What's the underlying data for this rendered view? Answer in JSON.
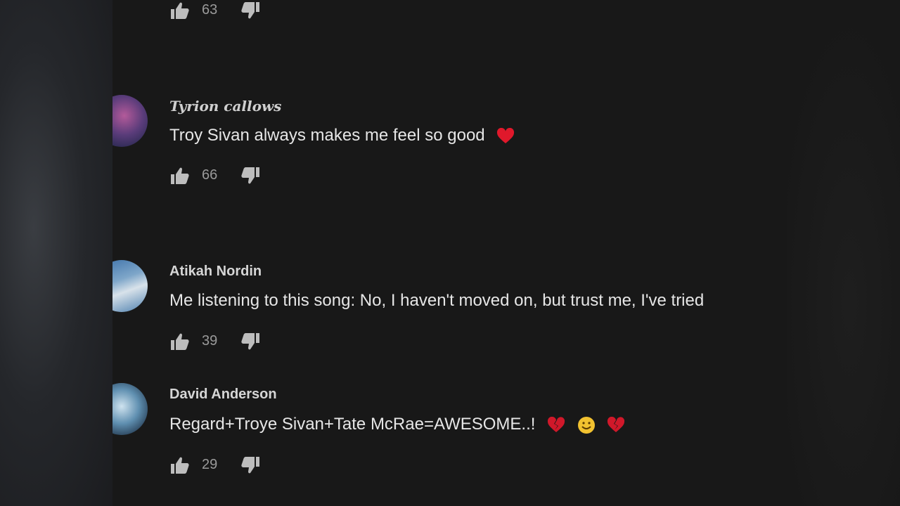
{
  "comments": [
    {
      "author": "",
      "text": "",
      "likes": "63"
    },
    {
      "author": "Tyrion callows",
      "text": "Troy Sivan always makes me feel so good",
      "likes": "66",
      "emoji": [
        "red-heart"
      ]
    },
    {
      "author": "Atikah Nordin",
      "text": "Me listening to this song: No, I haven't moved on, but trust me, I've tried",
      "likes": "39"
    },
    {
      "author": "David Anderson",
      "text": "Regard+Troye Sivan+Tate McRae=AWESOME..!",
      "likes": "29",
      "emoji": [
        "broken-heart",
        "smiling-face",
        "broken-heart"
      ]
    }
  ],
  "icons": {
    "like": "thumbs-up-icon",
    "dislike": "thumbs-down-icon"
  },
  "colors": {
    "background": "#181818",
    "text": "#e6e6e6",
    "author": "#d6d6d6",
    "count": "#9a9a9a",
    "heart": "#e0182b"
  }
}
